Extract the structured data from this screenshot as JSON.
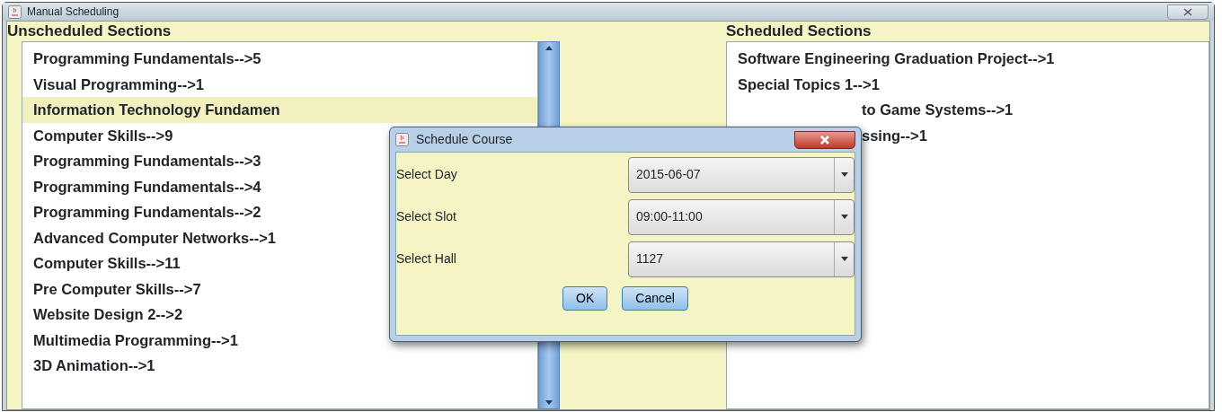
{
  "window": {
    "title": "Manual Scheduling"
  },
  "unscheduled": {
    "heading": "Unscheduled Sections",
    "items": [
      {
        "label": "Programming Fundamentals-->5",
        "selected": false
      },
      {
        "label": "Visual Programming-->1",
        "selected": false
      },
      {
        "label": "Information Technology Fundamen",
        "selected": true
      },
      {
        "label": "Computer Skills-->9",
        "selected": false
      },
      {
        "label": "Programming Fundamentals-->3",
        "selected": false
      },
      {
        "label": "Programming Fundamentals-->4",
        "selected": false
      },
      {
        "label": "Programming Fundamentals-->2",
        "selected": false
      },
      {
        "label": "Advanced Computer Networks-->1",
        "selected": false
      },
      {
        "label": "Computer Skills-->11",
        "selected": false
      },
      {
        "label": "Pre Computer Skills-->7",
        "selected": false
      },
      {
        "label": "Website Design 2-->2",
        "selected": false
      },
      {
        "label": "Multimedia Programming-->1",
        "selected": false
      },
      {
        "label": "3D Animation-->1",
        "selected": false
      }
    ]
  },
  "scheduled": {
    "heading": "Scheduled Sections",
    "items": [
      {
        "label": "Software Engineering Graduation Project-->1",
        "covered": false
      },
      {
        "label": "Special Topics 1-->1",
        "covered": false
      },
      {
        "label": "to Game Systems-->1",
        "covered": true
      },
      {
        "label": "ssing-->1",
        "covered": true
      }
    ]
  },
  "dialog": {
    "title": "Schedule Course",
    "fields": [
      {
        "label": "Select Day",
        "value": "2015-06-07"
      },
      {
        "label": "Select Slot",
        "value": "09:00-11:00"
      },
      {
        "label": "Select Hall",
        "value": "1127"
      }
    ],
    "buttons": [
      "OK",
      "Cancel"
    ]
  }
}
